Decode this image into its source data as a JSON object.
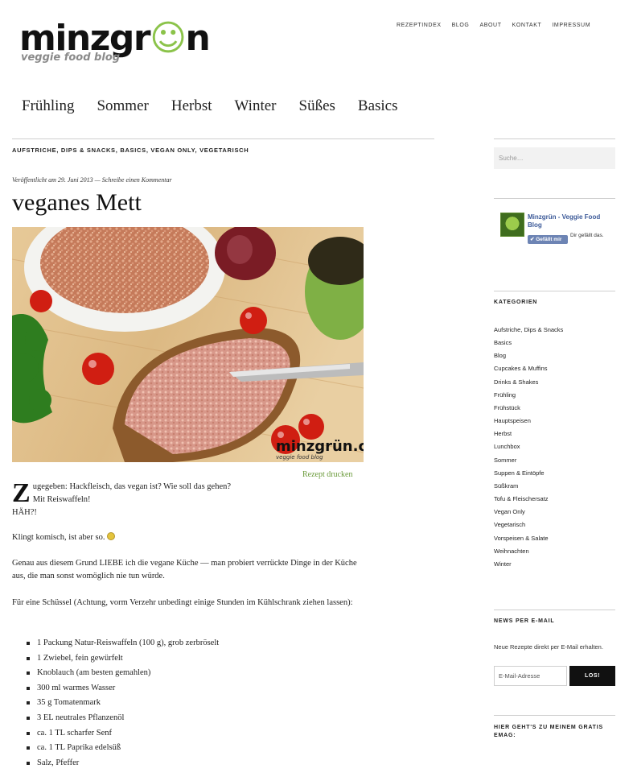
{
  "header": {
    "logo_word_a": "minzgr",
    "logo_word_smile": "☺",
    "logo_word_b": "n",
    "logo_tagline": "veggie food blog",
    "top_nav": [
      "REZEPTINDEX",
      "BLOG",
      "ABOUT",
      "KONTAKT",
      "IMPRESSUM"
    ],
    "main_nav": [
      "Frühling",
      "Sommer",
      "Herbst",
      "Winter",
      "Süßes",
      "Basics"
    ]
  },
  "post": {
    "categories": "AUFSTRICHE, DIPS & SNACKS, BASICS, VEGAN ONLY, VEGETARISCH",
    "published": "Veröffentlicht am 29. Juni 2013",
    "separator": " — ",
    "comment_link": "Schreibe einen Kommentar",
    "title": "veganes Mett",
    "image_watermark": "minzgrün.com",
    "image_watermark_tag": "veggie food blog",
    "print_link": "Rezept drucken",
    "dropcap": "Z",
    "intro_line1": "ugegeben: Hackfleisch, das vegan ist? Wie soll das gehen?",
    "intro_line2": "Mit Reiswaffeln!",
    "intro_line3": "HÄH?!",
    "p2": "Klingt komisch, ist aber so.",
    "p3": "Genau aus diesem Grund LIEBE ich die vegane Küche — man probiert verrückte Dinge in der Küche aus, die man sonst womöglich nie tun würde.",
    "p4": "Für eine Schüssel (Achtung, vorm Verzehr unbedingt einige Stunden im Kühlschrank ziehen lassen):",
    "ingredients": [
      "1 Packung Natur-Reiswaffeln (100 g), grob zerbröselt",
      "1 Zwiebel, fein gewürfelt",
      "Knoblauch (am besten gemahlen)",
      "300 ml warmes Wasser",
      "35 g Tomatenmark",
      "3 EL neutrales Pflanzenöl",
      "ca. 1 TL scharfer Senf",
      "ca. 1 TL Paprika edelsüß",
      "Salz, Pfeffer"
    ]
  },
  "sidebar": {
    "search_placeholder": "Suche…",
    "fb_name": "Minzgrün - Veggie Food Blog",
    "fb_like": "✔ Gefällt mir",
    "fb_like_text": "Dir gefällt das.",
    "categories_heading": "KATEGORIEN",
    "categories": [
      "Aufstriche, Dips & Snacks",
      "Basics",
      "Blog",
      "Cupcakes & Muffins",
      "Drinks & Shakes",
      "Frühling",
      "Frühstück",
      "Hauptspeisen",
      "Herbst",
      "Lunchbox",
      "Sommer",
      "Suppen & Eintöpfe",
      "Süßkram",
      "Tofu & Fleischersatz",
      "Vegan Only",
      "Vegetarisch",
      "Vorspeisen & Salate",
      "Weihnachten",
      "Winter"
    ],
    "news_heading": "NEWS PER E-MAIL",
    "news_text": "Neue Rezepte direkt per E-Mail erhalten.",
    "email_placeholder": "E-Mail-Adresse",
    "submit_label": "LOS!",
    "gratis_heading": "HIER GEHT'S ZU MEINEM GRATIS EMAG:"
  }
}
